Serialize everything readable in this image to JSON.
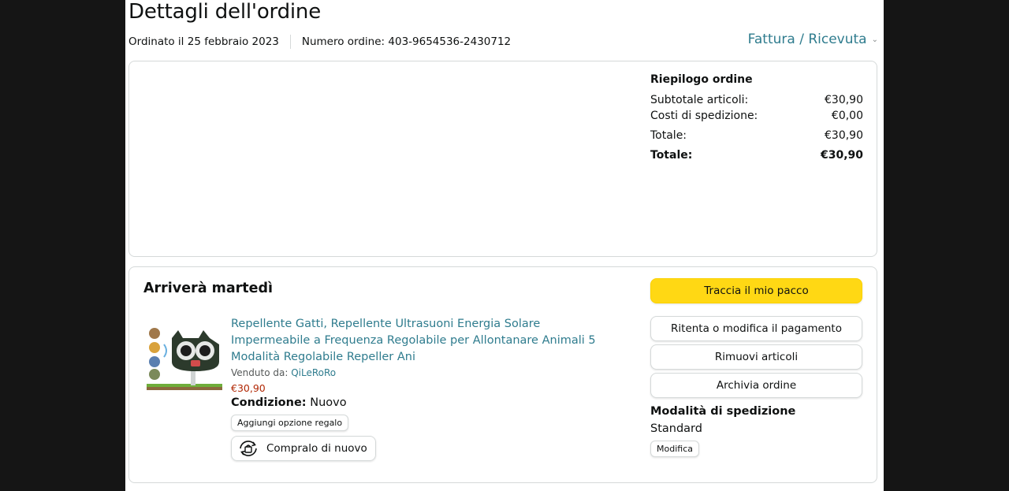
{
  "header": {
    "title": "Dettagli dell'ordine",
    "ordered_on": "Ordinato il 25 febbraio 2023",
    "order_number": "Numero ordine: 403-9654536-2430712",
    "invoice_label": "Fattura / Ricevuta"
  },
  "summary": {
    "heading": "Riepilogo ordine",
    "rows": [
      {
        "label": "Subtotale articoli:",
        "value": "€30,90"
      },
      {
        "label": "Costi di spedizione:",
        "value": "€0,00"
      },
      {
        "label": "Totale:",
        "value": "€30,90"
      },
      {
        "label": "Totale:",
        "value": "€30,90"
      }
    ]
  },
  "shipment": {
    "arrival": "Arriverà martedì",
    "product_title": "Repellente Gatti, Repellente Ultrasuoni Energia Solare Impermeabile a Frequenza Regolabile per Allontanare Animali 5 Modalità Regolabile Repeller Ani",
    "sold_by_label": "Venduto da: ",
    "seller": "QiLeRoRo",
    "price": "€30,90",
    "condition_label": "Condizione:",
    "condition_value": " Nuovo",
    "gift_option": "Aggiungi opzione regalo",
    "buy_again": "Compralo di nuovo"
  },
  "actions": {
    "track": "Traccia il mio pacco",
    "retry_payment": "Ritenta o modifica il pagamento",
    "remove_items": "Rimuovi articoli",
    "archive": "Archivia ordine",
    "shipping_heading": "Modalità di spedizione",
    "shipping_value": "Standard",
    "modify": "Modifica"
  },
  "colors": {
    "link": "#2f7c8e",
    "price": "#b12704",
    "primary_button": "#ffd814"
  }
}
